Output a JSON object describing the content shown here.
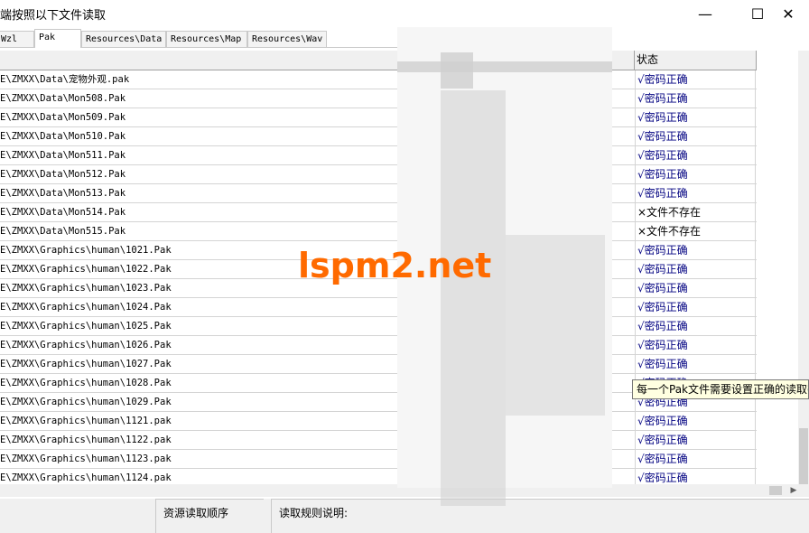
{
  "window": {
    "title": "端按照以下文件读取",
    "minimize_glyph": "—",
    "maximize_glyph": "☐",
    "close_glyph": "✕"
  },
  "tabs": [
    {
      "label": "Wzl",
      "active": false
    },
    {
      "label": "Pak",
      "active": true
    },
    {
      "label": "Resources\\Data",
      "active": false
    },
    {
      "label": "Resources\\Map",
      "active": false
    },
    {
      "label": "Resources\\Wav",
      "active": false
    }
  ],
  "table": {
    "status_header": "状态",
    "rows": [
      {
        "path": "E\\ZMXX\\Data\\宠物外观.pak",
        "status": "√密码正确",
        "ok": true
      },
      {
        "path": "E\\ZMXX\\Data\\Mon508.Pak",
        "status": "√密码正确",
        "ok": true
      },
      {
        "path": "E\\ZMXX\\Data\\Mon509.Pak",
        "status": "√密码正确",
        "ok": true
      },
      {
        "path": "E\\ZMXX\\Data\\Mon510.Pak",
        "status": "√密码正确",
        "ok": true
      },
      {
        "path": "E\\ZMXX\\Data\\Mon511.Pak",
        "status": "√密码正确",
        "ok": true
      },
      {
        "path": "E\\ZMXX\\Data\\Mon512.Pak",
        "status": "√密码正确",
        "ok": true
      },
      {
        "path": "E\\ZMXX\\Data\\Mon513.Pak",
        "status": "√密码正确",
        "ok": true
      },
      {
        "path": "E\\ZMXX\\Data\\Mon514.Pak",
        "status": "×文件不存在",
        "ok": false
      },
      {
        "path": "E\\ZMXX\\Data\\Mon515.Pak",
        "status": "×文件不存在",
        "ok": false
      },
      {
        "path": "E\\ZMXX\\Graphics\\human\\1021.Pak",
        "status": "√密码正确",
        "ok": true
      },
      {
        "path": "E\\ZMXX\\Graphics\\human\\1022.Pak",
        "status": "√密码正确",
        "ok": true
      },
      {
        "path": "E\\ZMXX\\Graphics\\human\\1023.Pak",
        "status": "√密码正确",
        "ok": true
      },
      {
        "path": "E\\ZMXX\\Graphics\\human\\1024.Pak",
        "status": "√密码正确",
        "ok": true
      },
      {
        "path": "E\\ZMXX\\Graphics\\human\\1025.Pak",
        "status": "√密码正确",
        "ok": true
      },
      {
        "path": "E\\ZMXX\\Graphics\\human\\1026.Pak",
        "status": "√密码正确",
        "ok": true
      },
      {
        "path": "E\\ZMXX\\Graphics\\human\\1027.Pak",
        "status": "√密码正确",
        "ok": true
      },
      {
        "path": "E\\ZMXX\\Graphics\\human\\1028.Pak",
        "status": "√密码正确",
        "ok": true
      },
      {
        "path": "E\\ZMXX\\Graphics\\human\\1029.Pak",
        "status": "√密码正确",
        "ok": true
      },
      {
        "path": "E\\ZMXX\\Graphics\\human\\1121.pak",
        "status": "√密码正确",
        "ok": true
      },
      {
        "path": "E\\ZMXX\\Graphics\\human\\1122.pak",
        "status": "√密码正确",
        "ok": true
      },
      {
        "path": "E\\ZMXX\\Graphics\\human\\1123.pak",
        "status": "√密码正确",
        "ok": true
      },
      {
        "path": "E\\ZMXX\\Graphics\\human\\1124.pak",
        "status": "√密码正确",
        "ok": true
      }
    ]
  },
  "tooltip": "每一个Pak文件需要设置正确的读取密码",
  "watermark": "lspm2.net",
  "bottom": {
    "order_label": "资源读取顺序",
    "rules_label": "读取规则说明:"
  },
  "scrollbar": {
    "right_arrow_glyph": "▶"
  },
  "colors": {
    "ok_text": "#000080",
    "watermark": "#ff6a00",
    "tooltip_bg": "#ffffe1"
  }
}
